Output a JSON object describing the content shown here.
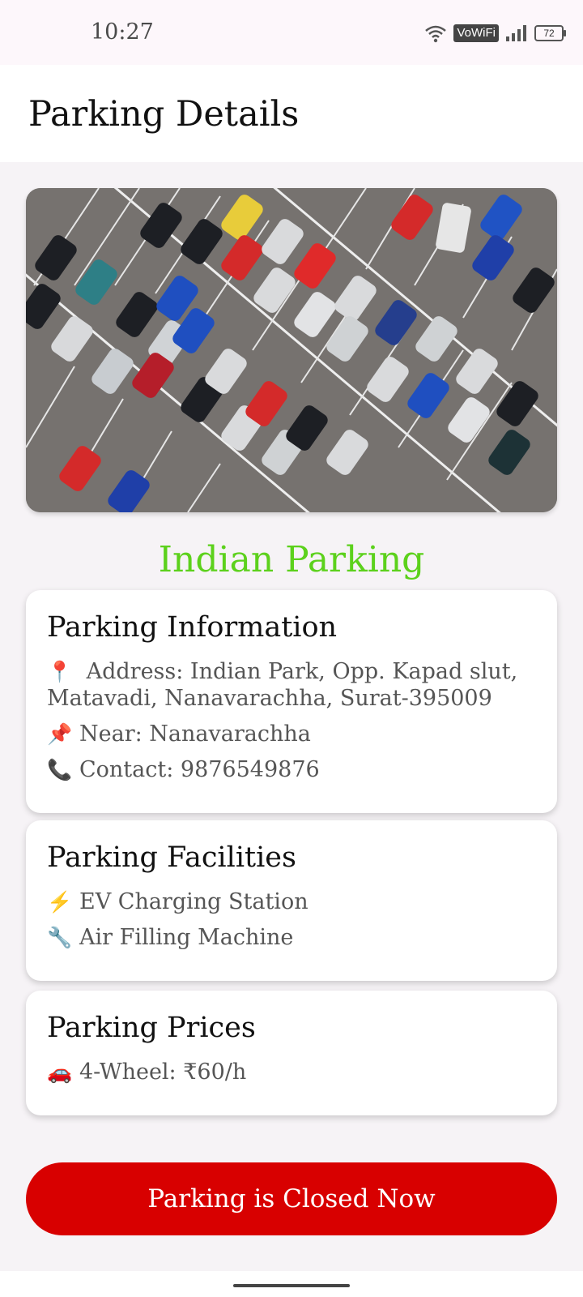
{
  "status": {
    "time": "10:27",
    "network_label": "VoWiFi",
    "battery": "72"
  },
  "header": {
    "title": "Parking Details"
  },
  "parking_name": "Indian Parking",
  "info_card": {
    "title": "Parking Information",
    "items": [
      {
        "icon": "round-pushpin-icon",
        "glyph": "📍",
        "text": "Address: Indian Park, Opp. Kapad slut, Matavadi, Nanavarachha, Surat-395009"
      },
      {
        "icon": "pushpin-icon",
        "glyph": "📌",
        "text": "Near: Nanavarachha"
      },
      {
        "icon": "phone-icon",
        "glyph": "📞",
        "text": "Contact: 9876549876"
      }
    ]
  },
  "facilities_card": {
    "title": "Parking Facilities",
    "items": [
      {
        "icon": "lightning-icon",
        "glyph": "⚡",
        "text": "EV Charging Station"
      },
      {
        "icon": "wrench-icon",
        "glyph": "🔧",
        "text": "Air Filling Machine"
      }
    ]
  },
  "prices_card": {
    "title": "Parking Prices",
    "items": [
      {
        "icon": "car-icon",
        "glyph": "🚗",
        "text": "4-Wheel: ₹60/h"
      }
    ]
  },
  "action_button": {
    "label": "Parking is Closed Now",
    "color": "#d80000"
  },
  "accent": {
    "name_color": "#5cd11c"
  }
}
